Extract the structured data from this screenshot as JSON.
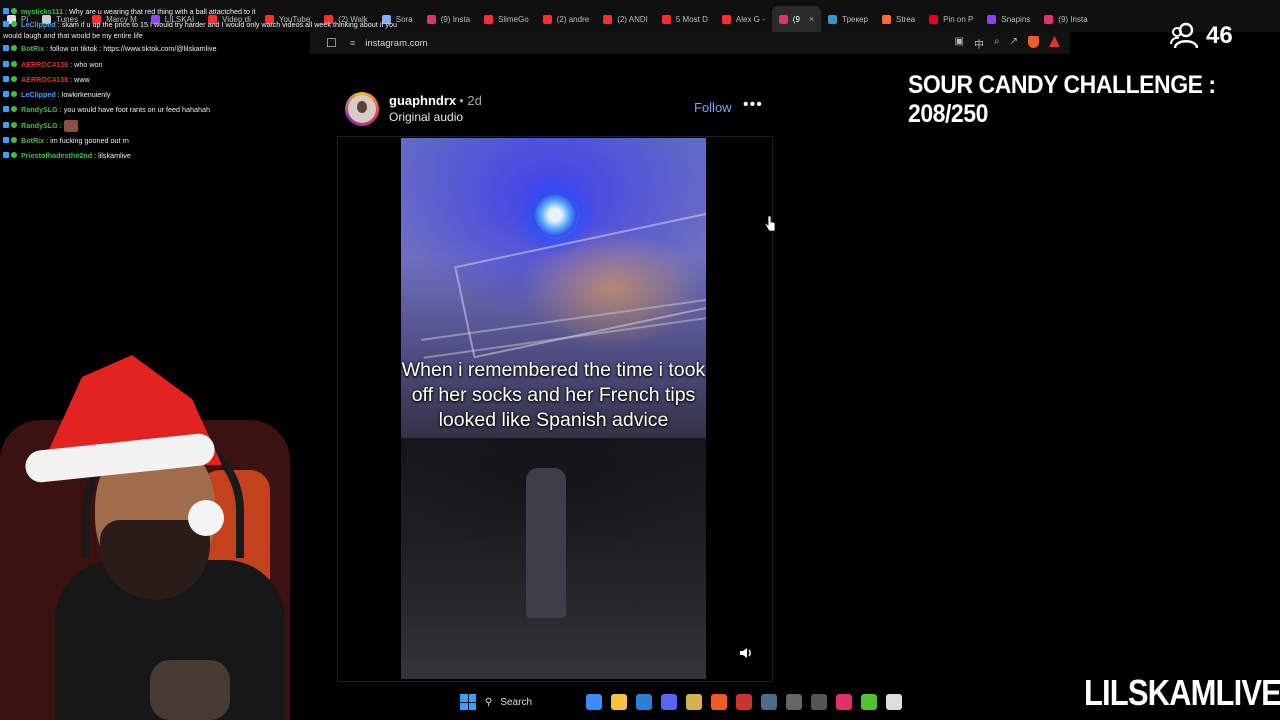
{
  "browser": {
    "tabs": [
      {
        "label": "Pi",
        "icon": "pinterest-icon",
        "color": "#e0e0e0"
      },
      {
        "label": "Tunes",
        "icon": "music-icon",
        "color": "#cfcfcf"
      },
      {
        "label": "Marcy M",
        "icon": "youtube-icon",
        "color": "#ff2d2d"
      },
      {
        "label": "LILSKAI",
        "icon": "twitch-icon",
        "color": "#9146ff"
      },
      {
        "label": "Video di",
        "icon": "youtube-icon",
        "color": "#ff2d2d"
      },
      {
        "label": "YouTube",
        "icon": "youtube-icon",
        "color": "#ff2d2d"
      },
      {
        "label": "(2) Walk",
        "icon": "youtube-icon",
        "color": "#ff2d2d"
      },
      {
        "label": "Sora",
        "icon": "sora-icon",
        "color": "#7fb0ff"
      },
      {
        "label": "(9) Insta",
        "icon": "instagram-icon",
        "color": "#e1306c"
      },
      {
        "label": "SlimeGo",
        "icon": "youtube-icon",
        "color": "#ff2d2d"
      },
      {
        "label": "(2) andre",
        "icon": "youtube-icon",
        "color": "#ff2d2d"
      },
      {
        "label": "(2) ANDI",
        "icon": "youtube-icon",
        "color": "#ff2d2d"
      },
      {
        "label": "5 Most D",
        "icon": "youtube-icon",
        "color": "#ff2d2d"
      },
      {
        "label": "Alex G -",
        "icon": "youtube-icon",
        "color": "#ff2d2d"
      },
      {
        "label": "(9",
        "icon": "instagram-icon",
        "color": "#e1306c",
        "active": true
      },
      {
        "label": "Трекер",
        "icon": "tracker-icon",
        "color": "#39c"
      },
      {
        "label": "Strea",
        "icon": "streamlabs-icon",
        "color": "#ff6a3d"
      },
      {
        "label": "Pin on P",
        "icon": "pinterest-icon",
        "color": "#e60023"
      },
      {
        "label": "Snapins",
        "icon": "snapins-icon",
        "color": "#8a3ffc"
      },
      {
        "label": "(9) Insta",
        "icon": "instagram-icon",
        "color": "#e1306c"
      }
    ],
    "url": "instagram.com"
  },
  "chat": [
    {
      "user": "mysticks111",
      "color": "#3fbf3f",
      "message": "Why are u wearing that red thing with a ball attactched to it"
    },
    {
      "user": "LeClipped",
      "color": "#3aa0ff",
      "message": "skam if u up the price to 15 I would try harder and I would only watch videos all week thinking about if you would laugh and that would be my entire life"
    },
    {
      "user": "BotRix",
      "color": "#3fbf3f",
      "message": "follow on tiktok : https://www.tiktok.com/@lilskamlive"
    },
    {
      "user": "AERROC4138",
      "color": "#e0362c",
      "message": "who won"
    },
    {
      "user": "AERROC4138",
      "color": "#e0362c",
      "message": "www"
    },
    {
      "user": "LeClipped",
      "color": "#3aa0ff",
      "message": "lowkirkenuienly"
    },
    {
      "user": "RandySLG",
      "color": "#3fbf3f",
      "message": "you would have foot rants on ur feed hahahah"
    },
    {
      "user": "RandySLG",
      "color": "#3fbf3f",
      "message": ""
    },
    {
      "user": "BotRix",
      "color": "#3fbf3f",
      "message": "im fucking gooned out rn"
    },
    {
      "user": "Priestofhadesthe2nd",
      "color": "#3fbf3f",
      "message": "lilskamlive"
    }
  ],
  "overlay": {
    "viewer_count": "46",
    "challenge": "SOUR CANDY CHALLENGE : 208/250",
    "brand": "LILSKAMLIVE"
  },
  "post": {
    "username": "guaphndrx",
    "age": "• 2d",
    "audio": "Original audio",
    "follow_label": "Follow",
    "more_label": "•••",
    "caption": "When i remembered the time i took off her socks and her French tips looked like Spanish advice"
  },
  "taskbar": {
    "search_label": "Search",
    "apps": [
      {
        "icon": "copilot-icon",
        "color": "#3b8cff"
      },
      {
        "icon": "file-explorer-icon",
        "color": "#f5c242"
      },
      {
        "icon": "store-icon",
        "color": "#2d7fd6"
      },
      {
        "icon": "discord-icon",
        "color": "#5865f2"
      },
      {
        "icon": "shield-icon",
        "color": "#d6b04a"
      },
      {
        "icon": "brave-icon",
        "color": "#f25b24"
      },
      {
        "icon": "obs-icon",
        "color": "#cc3333"
      },
      {
        "icon": "steam-icon",
        "color": "#4c6b8a"
      },
      {
        "icon": "app-icon",
        "color": "#666"
      },
      {
        "icon": "4k-icon",
        "color": "#555"
      },
      {
        "icon": "instagram-icon",
        "color": "#e1306c"
      },
      {
        "icon": "bluestacks-icon",
        "color": "#52c234"
      },
      {
        "icon": "capcut-icon",
        "color": "#ddd"
      }
    ]
  }
}
